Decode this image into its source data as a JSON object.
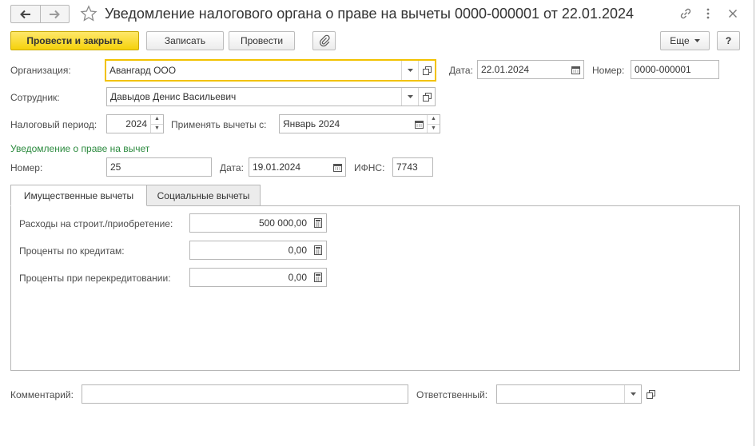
{
  "window": {
    "title": "Уведомление налогового органа о праве на вычеты 0000-000001 от 22.01.2024"
  },
  "toolbar": {
    "post_close_label": "Провести и закрыть",
    "save_label": "Записать",
    "post_label": "Провести",
    "more_label": "Еще",
    "help_label": "?"
  },
  "header": {
    "organization": {
      "label": "Организация:",
      "value": "Авангард ООО"
    },
    "date": {
      "label": "Дата:",
      "value": "22.01.2024"
    },
    "number": {
      "label": "Номер:",
      "value": "0000-000001"
    },
    "employee": {
      "label": "Сотрудник:",
      "value": "Давыдов Денис Васильевич"
    },
    "tax_period": {
      "label": "Налоговый период:",
      "value": "2024"
    },
    "apply_from": {
      "label": "Применять вычеты с:",
      "value": "Январь 2024"
    }
  },
  "notice": {
    "section_title": "Уведомление о праве на вычет",
    "number": {
      "label": "Номер:",
      "value": "25"
    },
    "date": {
      "label": "Дата:",
      "value": "19.01.2024"
    },
    "ifns": {
      "label": "ИФНС:",
      "value": "7743"
    }
  },
  "tabs": [
    {
      "label": "Имущественные вычеты",
      "active": true
    },
    {
      "label": "Социальные вычеты",
      "active": false
    }
  ],
  "property_deductions": [
    {
      "label": "Расходы на строит./приобретение:",
      "value": "500 000,00"
    },
    {
      "label": "Проценты по кредитам:",
      "value": "0,00"
    },
    {
      "label": "Проценты при перекредитовании:",
      "value": "0,00"
    }
  ],
  "footer": {
    "comment": {
      "label": "Комментарий:",
      "value": ""
    },
    "responsible": {
      "label": "Ответственный:",
      "value": ""
    }
  },
  "colors": {
    "primary_button": "#f5d20b",
    "focus_border": "#f2c200",
    "section_title": "#2b8a3e"
  },
  "icons": {
    "back": "arrow-left-icon",
    "forward": "arrow-right-icon",
    "favorite": "star-icon",
    "link": "link-icon",
    "more_actions": "kebab-icon",
    "close": "close-icon",
    "attach": "paperclip-icon",
    "calendar": "calendar-icon",
    "calculator": "calculator-icon",
    "open": "open-window-icon",
    "dropdown": "chevron-down-icon"
  }
}
